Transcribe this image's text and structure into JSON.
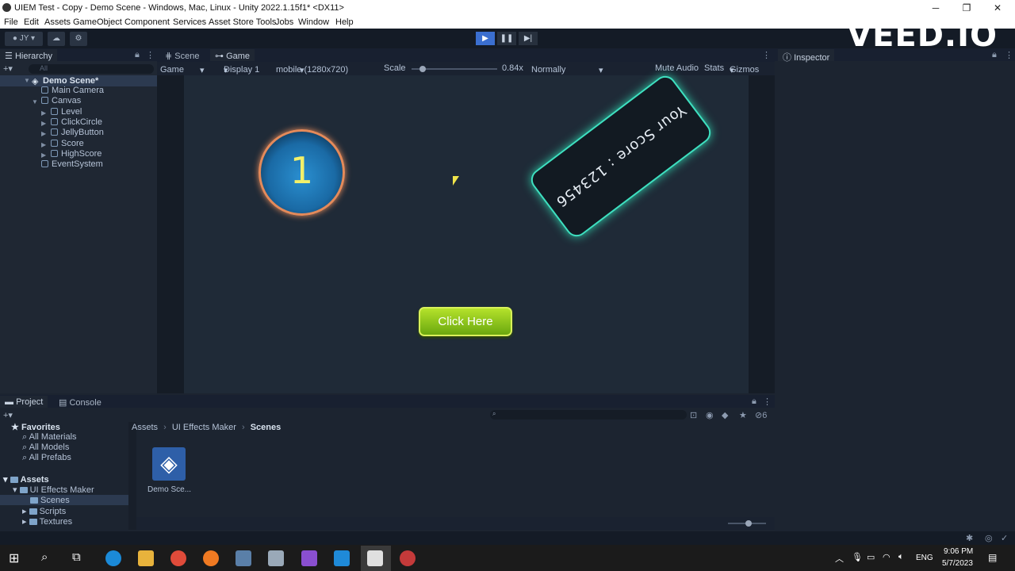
{
  "window": {
    "title": "UIEM Test - Copy - Demo Scene - Windows, Mac, Linux - Unity 2022.1.15f1* <DX11>",
    "minimize": "─",
    "restore": "❐",
    "close": "✕"
  },
  "menu": [
    "File",
    "Edit",
    "Assets",
    "GameObject",
    "Component",
    "Services",
    "Asset Store Tools",
    "Jobs",
    "Window",
    "Help"
  ],
  "toolbar": {
    "account": "JY",
    "play_icon": "▶",
    "pause_icon": "❚❚",
    "step_icon": "▶|",
    "watermark": "VEED.IO"
  },
  "hierarchy": {
    "tab": "Hierarchy",
    "search_placeholder": "All",
    "scene": "Demo Scene*",
    "items": [
      "Main Camera",
      "Canvas",
      "Level",
      "ClickCircle",
      "JellyButton",
      "Score",
      "HighScore",
      "EventSystem"
    ]
  },
  "center_tabs": [
    "Scene",
    "Game"
  ],
  "game_bar": {
    "mode": "Game",
    "display": "Display 1",
    "resolution": "mobile (1280x720)",
    "scale_label": "Scale",
    "scale_value": "0.84x",
    "scale_fraction": 0.1,
    "vsync": "Normally",
    "mute": "Mute Audio",
    "stats": "Stats",
    "gizmos": "Gizmos"
  },
  "game": {
    "level_number": "1",
    "score_text": "Your Score : 123456",
    "button_label": "Click Here"
  },
  "inspector": {
    "tab": "Inspector"
  },
  "bottom_tabs": [
    "Project",
    "Console"
  ],
  "project": {
    "favorites_label": "Favorites",
    "favorites": [
      "All Materials",
      "All Models",
      "All Prefabs"
    ],
    "assets_label": "Assets",
    "tree": [
      "UI Effects Maker",
      "Scenes",
      "Scripts",
      "Textures"
    ],
    "breadcrumb": [
      "Assets",
      "UI Effects Maker",
      "Scenes"
    ],
    "asset_name": "Demo Sce...",
    "count": "6"
  },
  "taskbar": {
    "time": "9:06 PM",
    "date": "5/7/2023",
    "lang": "ENG"
  },
  "colors": {
    "accent_button": "#8bc21a",
    "score_glow": "#3ee0c0",
    "circle": "#1a6aa5"
  }
}
